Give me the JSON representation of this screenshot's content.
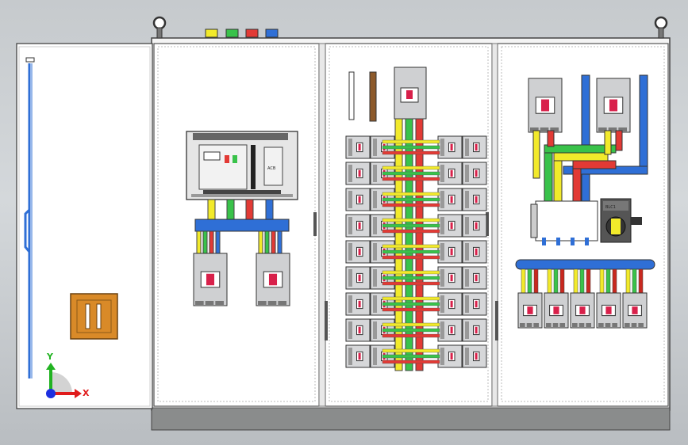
{
  "colors": {
    "background": "#c8ccd0",
    "cabinet": "#ffffff",
    "plinth": "#8a8c8c",
    "phase_yellow": "#f2ea2b",
    "phase_green": "#39c24a",
    "phase_red": "#e23a35",
    "phase_blue": "#2f6fd6",
    "breaker_body": "#cfd0d2",
    "breaker_handle": "#d8204a",
    "handle_orange": "#d98a28"
  },
  "markings": {
    "main_breaker_tag": "ACB",
    "isolator_tag": "BLC1"
  },
  "axis_triad": {
    "y_label": "Y",
    "x_label": "X",
    "y_color": "#21b321",
    "x_color": "#e01b1b"
  },
  "phase_terminals": [
    "yellow-icon",
    "green-icon",
    "red-icon",
    "blue-icon"
  ],
  "layout_counts": {
    "section1_outgoing_breakers": 2,
    "section2_breaker_rows": 9,
    "section2_breakers_per_side": 2,
    "section3_incoming_breakers": 2,
    "section3_outgoing_breakers": 5
  }
}
